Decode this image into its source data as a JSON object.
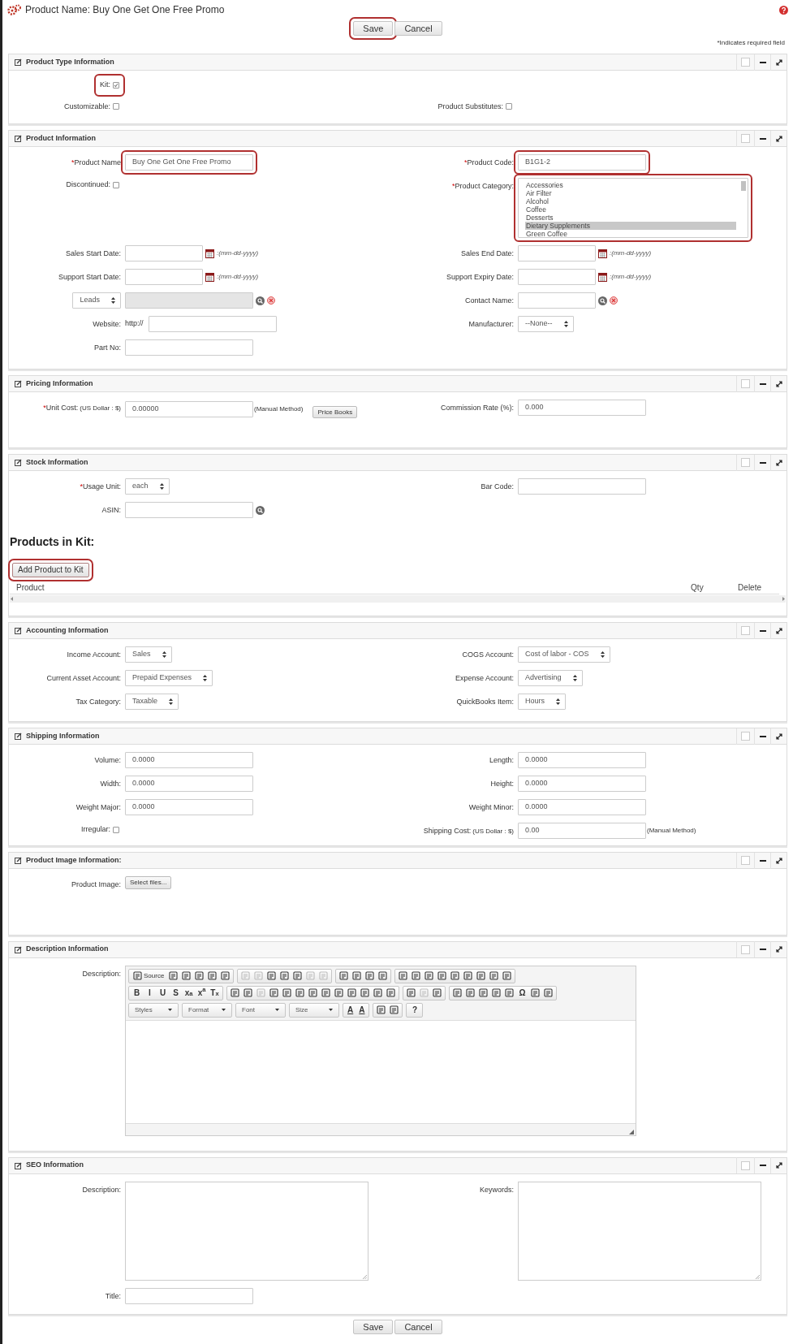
{
  "header": {
    "title": "Product Name: Buy One Get One Free Promo"
  },
  "top_buttons": [
    {
      "label": "Save",
      "highlighted": true
    },
    {
      "label": "Cancel",
      "highlighted": false
    }
  ],
  "required_note": "*Indicates required field",
  "sections": [
    {
      "title": "Product Type Information",
      "rows": [
        {
          "left": {
            "kind": "checkbox",
            "label": "Kit:",
            "checked": true,
            "highlighted": true
          }
        },
        {
          "left": {
            "kind": "checkbox",
            "label": "Customizable:",
            "checked": false
          },
          "right": {
            "kind": "checkbox",
            "label": "Product Substitutes:",
            "checked": false
          }
        }
      ]
    },
    {
      "title": "Product Information",
      "rows": [
        {
          "left": {
            "kind": "text",
            "mark": "*",
            "label": "Product Name",
            "value": "Buy One Get One Free Promo",
            "highlighted": true
          },
          "right": {
            "kind": "text",
            "mark": "*",
            "label": "Product Code:",
            "value": "B1G1-2",
            "highlighted": true
          }
        },
        {
          "left": {
            "kind": "checkbox",
            "label": "Discontinued:",
            "checked": false
          },
          "right": {
            "kind": "listbox",
            "mark": "*",
            "label": "Product Category:",
            "highlighted": true,
            "options": [
              {
                "text": "Accessories",
                "selected": false
              },
              {
                "text": "Air Filter",
                "selected": false
              },
              {
                "text": "Alcohol",
                "selected": false
              },
              {
                "text": "Coffee",
                "selected": false
              },
              {
                "text": "Desserts",
                "selected": false
              },
              {
                "text": "Dietary Supplements",
                "selected": true
              },
              {
                "text": "Green Coffee",
                "selected": false
              }
            ]
          }
        },
        {
          "left": {
            "kind": "date",
            "label": "Sales Start Date:",
            "hint": ":(mm-dd-yyyy)"
          },
          "right": {
            "kind": "date",
            "label": "Sales End Date:",
            "hint": ":(mm-dd-yyyy)"
          }
        },
        {
          "left": {
            "kind": "date",
            "label": "Support Start Date:",
            "hint": ":(mm-dd-yyyy)"
          },
          "right": {
            "kind": "date",
            "label": "Support Expiry Date:",
            "hint": ":(mm-dd-yyyy)"
          }
        },
        {
          "left": {
            "kind": "lookup",
            "module": "Leads",
            "disabled": true
          },
          "right": {
            "kind": "lookup",
            "label": "Contact Name:",
            "disabled": false
          }
        },
        {
          "left": {
            "kind": "url",
            "label": "Website:",
            "prefix": "http://"
          },
          "right": {
            "kind": "select",
            "label": "Manufacturer:",
            "value": "--None--"
          }
        },
        {
          "left": {
            "kind": "text",
            "label": "Part No:"
          }
        }
      ]
    },
    {
      "title": "Pricing Information",
      "rows": [
        {
          "left": {
            "kind": "money",
            "mark": "*",
            "label": "Unit Cost:",
            "note": "(US Dollar : $)",
            "value": "0.00000",
            "suffix": "(Manual Method)",
            "button": "Price Books"
          },
          "right": {
            "kind": "text",
            "label": "Commission Rate (%):",
            "value": "0.000"
          }
        }
      ]
    },
    {
      "title": "Stock Information",
      "rows": [
        {
          "left": {
            "kind": "select",
            "mark": "*",
            "label": "Usage Unit:",
            "value": "each"
          },
          "right": {
            "kind": "text",
            "label": "Bar Code:"
          }
        },
        {
          "left": {
            "kind": "text",
            "label": "ASIN:",
            "search": true
          }
        }
      ],
      "kit": {
        "heading": "Products in Kit:",
        "button": {
          "label": "Add Product to Kit",
          "highlighted": true
        },
        "columns": [
          "Product",
          "Qty",
          "Delete"
        ]
      }
    },
    {
      "title": "Accounting Information",
      "rows": [
        {
          "left": {
            "kind": "select",
            "label": "Income Account:",
            "value": "Sales"
          },
          "right": {
            "kind": "select",
            "label": "COGS Account:",
            "value": "Cost of labor - COS"
          }
        },
        {
          "left": {
            "kind": "select",
            "label": "Current Asset Account:",
            "value": "Prepaid Expenses"
          },
          "right": {
            "kind": "select",
            "label": "Expense Account:",
            "value": "Advertising"
          }
        },
        {
          "left": {
            "kind": "select",
            "label": "Tax Category:",
            "value": "Taxable"
          },
          "right": {
            "kind": "select",
            "label": "QuickBooks Item:",
            "value": "Hours"
          }
        }
      ]
    },
    {
      "title": "Shipping Information",
      "rows": [
        {
          "left": {
            "kind": "text",
            "label": "Volume:",
            "value": "0.0000"
          },
          "right": {
            "kind": "text",
            "label": "Length:",
            "value": "0.0000"
          }
        },
        {
          "left": {
            "kind": "text",
            "label": "Width:",
            "value": "0.0000"
          },
          "right": {
            "kind": "text",
            "label": "Height:",
            "value": "0.0000"
          }
        },
        {
          "left": {
            "kind": "text",
            "label": "Weight Major:",
            "value": "0.0000"
          },
          "right": {
            "kind": "text",
            "label": "Weight Minor:",
            "value": "0.0000"
          }
        },
        {
          "left": {
            "kind": "checkbox",
            "label": "Irregular:",
            "checked": false
          },
          "right": {
            "kind": "money",
            "label": "Shipping Cost:",
            "note": "(US Dollar : $)",
            "value": "0.00",
            "suffix": "(Manual Method)"
          }
        }
      ]
    },
    {
      "title": "Product Image Information:",
      "rows": [
        {
          "left": {
            "kind": "file",
            "label": "Product Image:",
            "button": "Select files..."
          }
        }
      ]
    },
    {
      "title": "Description Information",
      "rows": [
        {
          "left": {
            "kind": "editor",
            "label": "Description:",
            "toolbar": [
              [
                [
                  {
                    "kind": "text",
                    "text": "Source"
                  },
                  {
                    "kind": "icon",
                    "disabled": false
                  },
                  {
                    "kind": "icon",
                    "disabled": false
                  },
                  {
                    "kind": "icon",
                    "disabled": false
                  },
                  {
                    "kind": "icon",
                    "disabled": false
                  },
                  {
                    "kind": "icon",
                    "disabled": false
                  }
                ],
                [
                  {
                    "kind": "icon",
                    "disabled": true
                  },
                  {
                    "kind": "icon",
                    "disabled": true
                  },
                  {
                    "kind": "icon",
                    "disabled": false
                  },
                  {
                    "kind": "icon",
                    "disabled": false
                  },
                  {
                    "kind": "icon",
                    "disabled": false
                  },
                  {
                    "kind": "icon",
                    "disabled": true
                  },
                  {
                    "kind": "icon",
                    "disabled": true
                  }
                ],
                [
                  {
                    "kind": "icon",
                    "disabled": false
                  },
                  {
                    "kind": "icon",
                    "disabled": false
                  },
                  {
                    "kind": "icon",
                    "disabled": false
                  },
                  {
                    "kind": "icon",
                    "disabled": false
                  }
                ],
                [
                  {
                    "kind": "icon",
                    "disabled": false
                  },
                  {
                    "kind": "icon",
                    "disabled": false
                  },
                  {
                    "kind": "icon",
                    "disabled": false
                  },
                  {
                    "kind": "icon",
                    "disabled": false
                  },
                  {
                    "kind": "icon",
                    "disabled": false
                  },
                  {
                    "kind": "icon",
                    "disabled": false
                  },
                  {
                    "kind": "icon",
                    "disabled": false
                  },
                  {
                    "kind": "icon",
                    "disabled": false
                  },
                  {
                    "kind": "icon",
                    "disabled": false
                  }
                ]
              ],
              [
                [
                  {
                    "kind": "glyph",
                    "text": "B"
                  },
                  {
                    "kind": "glyph",
                    "text": "I"
                  },
                  {
                    "kind": "glyph",
                    "text": "U"
                  },
                  {
                    "kind": "glyph",
                    "text": "S"
                  },
                  {
                    "kind": "glyph",
                    "text": "x$_{a}$"
                  },
                  {
                    "kind": "glyph",
                    "text": "x$^{a}$"
                  },
                  {
                    "kind": "glyph",
                    "text": "T$_{x}$"
                  }
                ],
                [
                  {
                    "kind": "icon",
                    "disabled": false
                  },
                  {
                    "kind": "icon",
                    "disabled": false
                  },
                  {
                    "kind": "icon",
                    "disabled": true
                  },
                  {
                    "kind": "icon",
                    "disabled": false
                  },
                  {
                    "kind": "icon",
                    "disabled": false
                  },
                  {
                    "kind": "icon",
                    "disabled": false
                  },
                  {
                    "kind": "icon",
                    "disabled": false
                  },
                  {
                    "kind": "icon",
                    "disabled": false
                  },
                  {
                    "kind": "icon",
                    "disabled": false
                  },
                  {
                    "kind": "icon",
                    "disabled": false
                  },
                  {
                    "kind": "icon",
                    "disabled": false
                  },
                  {
                    "kind": "icon",
                    "disabled": false
                  },
                  {
                    "kind": "icon",
                    "disabled": false
                  }
                ],
                [
                  {
                    "kind": "icon",
                    "disabled": false
                  },
                  {
                    "kind": "icon",
                    "disabled": true
                  },
                  {
                    "kind": "icon",
                    "disabled": false
                  }
                ],
                [
                  {
                    "kind": "icon",
                    "disabled": false
                  },
                  {
                    "kind": "icon",
                    "disabled": false
                  },
                  {
                    "kind": "icon",
                    "disabled": false
                  },
                  {
                    "kind": "icon",
                    "disabled": false
                  },
                  {
                    "kind": "icon",
                    "disabled": false
                  },
                  {
                    "kind": "glyph",
                    "text": "Ω"
                  },
                  {
                    "kind": "icon",
                    "disabled": false
                  },
                  {
                    "kind": "icon",
                    "disabled": false
                  }
                ]
              ],
              [
                [
                  {
                    "kind": "combo",
                    "text": "Styles"
                  }
                ],
                [
                  {
                    "kind": "combo",
                    "text": "Format"
                  }
                ],
                [
                  {
                    "kind": "combo",
                    "text": "Font"
                  }
                ],
                [
                  {
                    "kind": "combo",
                    "text": "Size"
                  }
                ],
                [
                  {
                    "kind": "color",
                    "text": "A"
                  },
                  {
                    "kind": "color",
                    "text": "A"
                  }
                ],
                [
                  {
                    "kind": "icon",
                    "disabled": false
                  },
                  {
                    "kind": "icon",
                    "disabled": false
                  }
                ],
                [
                  {
                    "kind": "glyph",
                    "text": "?"
                  }
                ]
              ]
            ]
          }
        }
      ]
    },
    {
      "title": "SEO Information",
      "rows": [
        {
          "left": {
            "kind": "textarea",
            "label": "Description:"
          },
          "right": {
            "kind": "textarea",
            "label": "Keywords:"
          }
        },
        {
          "left": {
            "kind": "text",
            "label": "Title:"
          }
        }
      ]
    }
  ],
  "bottom_buttons": [
    {
      "label": "Save",
      "highlighted": false
    },
    {
      "label": "Cancel",
      "highlighted": false
    }
  ]
}
